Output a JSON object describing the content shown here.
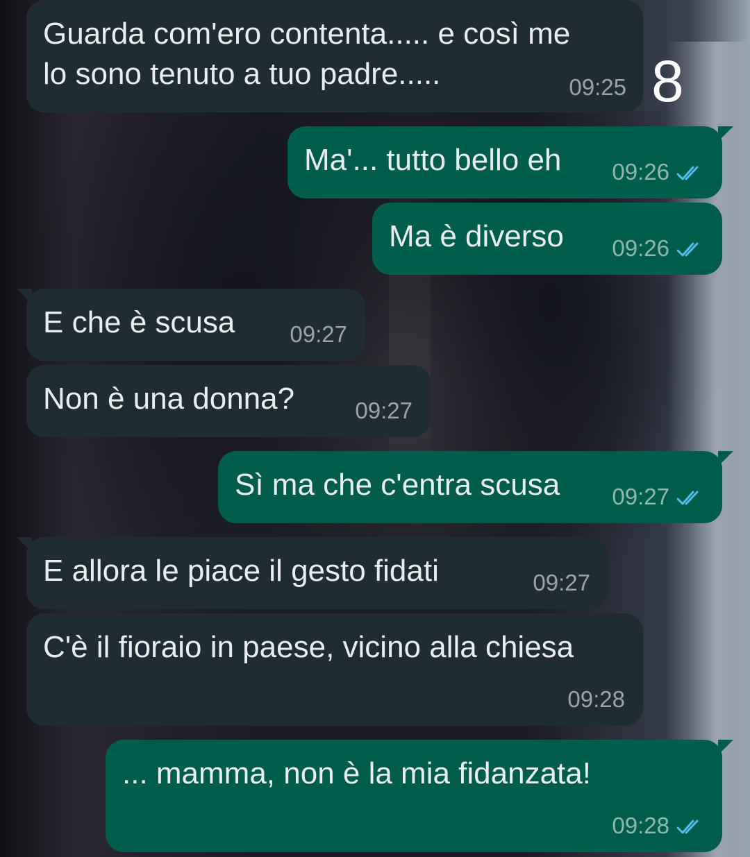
{
  "colors": {
    "incoming_bubble": "#202c33",
    "outgoing_bubble": "#005c4b",
    "read_ticks": "#53bdeb",
    "text": "#e9edef"
  },
  "overlay_number": "8",
  "messages": [
    {
      "direction": "in",
      "lines": [
        "Guarda com'ero contenta..... e così me",
        "lo sono tenuto a tuo padre....."
      ],
      "time": "09:25"
    },
    {
      "direction": "out",
      "text": "Ma'... tutto bello eh",
      "time": "09:26",
      "status": "read"
    },
    {
      "direction": "out",
      "text": "Ma è diverso",
      "time": "09:26",
      "status": "read"
    },
    {
      "direction": "in",
      "text": "E che è scusa",
      "time": "09:27"
    },
    {
      "direction": "in",
      "text": "Non è una donna?",
      "time": "09:27"
    },
    {
      "direction": "out",
      "text": "Sì ma che c'entra scusa",
      "time": "09:27",
      "status": "read"
    },
    {
      "direction": "in",
      "text": "E allora le piace il gesto fidati",
      "time": "09:27"
    },
    {
      "direction": "in",
      "text": "C'è il fioraio in paese, vicino alla chiesa",
      "time": "09:28"
    },
    {
      "direction": "out",
      "text": "... mamma, non è la mia fidanzata!",
      "time": "09:28",
      "status": "read"
    }
  ]
}
